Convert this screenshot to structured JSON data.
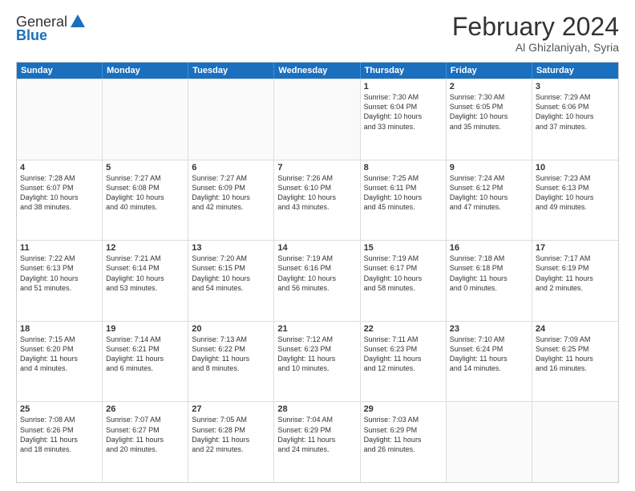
{
  "logo": {
    "general": "General",
    "blue": "Blue"
  },
  "title": "February 2024",
  "location": "Al Ghizlaniyah, Syria",
  "days_of_week": [
    "Sunday",
    "Monday",
    "Tuesday",
    "Wednesday",
    "Thursday",
    "Friday",
    "Saturday"
  ],
  "weeks": [
    [
      {
        "day": "",
        "text": ""
      },
      {
        "day": "",
        "text": ""
      },
      {
        "day": "",
        "text": ""
      },
      {
        "day": "",
        "text": ""
      },
      {
        "day": "1",
        "text": "Sunrise: 7:30 AM\nSunset: 6:04 PM\nDaylight: 10 hours\nand 33 minutes."
      },
      {
        "day": "2",
        "text": "Sunrise: 7:30 AM\nSunset: 6:05 PM\nDaylight: 10 hours\nand 35 minutes."
      },
      {
        "day": "3",
        "text": "Sunrise: 7:29 AM\nSunset: 6:06 PM\nDaylight: 10 hours\nand 37 minutes."
      }
    ],
    [
      {
        "day": "4",
        "text": "Sunrise: 7:28 AM\nSunset: 6:07 PM\nDaylight: 10 hours\nand 38 minutes."
      },
      {
        "day": "5",
        "text": "Sunrise: 7:27 AM\nSunset: 6:08 PM\nDaylight: 10 hours\nand 40 minutes."
      },
      {
        "day": "6",
        "text": "Sunrise: 7:27 AM\nSunset: 6:09 PM\nDaylight: 10 hours\nand 42 minutes."
      },
      {
        "day": "7",
        "text": "Sunrise: 7:26 AM\nSunset: 6:10 PM\nDaylight: 10 hours\nand 43 minutes."
      },
      {
        "day": "8",
        "text": "Sunrise: 7:25 AM\nSunset: 6:11 PM\nDaylight: 10 hours\nand 45 minutes."
      },
      {
        "day": "9",
        "text": "Sunrise: 7:24 AM\nSunset: 6:12 PM\nDaylight: 10 hours\nand 47 minutes."
      },
      {
        "day": "10",
        "text": "Sunrise: 7:23 AM\nSunset: 6:13 PM\nDaylight: 10 hours\nand 49 minutes."
      }
    ],
    [
      {
        "day": "11",
        "text": "Sunrise: 7:22 AM\nSunset: 6:13 PM\nDaylight: 10 hours\nand 51 minutes."
      },
      {
        "day": "12",
        "text": "Sunrise: 7:21 AM\nSunset: 6:14 PM\nDaylight: 10 hours\nand 53 minutes."
      },
      {
        "day": "13",
        "text": "Sunrise: 7:20 AM\nSunset: 6:15 PM\nDaylight: 10 hours\nand 54 minutes."
      },
      {
        "day": "14",
        "text": "Sunrise: 7:19 AM\nSunset: 6:16 PM\nDaylight: 10 hours\nand 56 minutes."
      },
      {
        "day": "15",
        "text": "Sunrise: 7:19 AM\nSunset: 6:17 PM\nDaylight: 10 hours\nand 58 minutes."
      },
      {
        "day": "16",
        "text": "Sunrise: 7:18 AM\nSunset: 6:18 PM\nDaylight: 11 hours\nand 0 minutes."
      },
      {
        "day": "17",
        "text": "Sunrise: 7:17 AM\nSunset: 6:19 PM\nDaylight: 11 hours\nand 2 minutes."
      }
    ],
    [
      {
        "day": "18",
        "text": "Sunrise: 7:15 AM\nSunset: 6:20 PM\nDaylight: 11 hours\nand 4 minutes."
      },
      {
        "day": "19",
        "text": "Sunrise: 7:14 AM\nSunset: 6:21 PM\nDaylight: 11 hours\nand 6 minutes."
      },
      {
        "day": "20",
        "text": "Sunrise: 7:13 AM\nSunset: 6:22 PM\nDaylight: 11 hours\nand 8 minutes."
      },
      {
        "day": "21",
        "text": "Sunrise: 7:12 AM\nSunset: 6:23 PM\nDaylight: 11 hours\nand 10 minutes."
      },
      {
        "day": "22",
        "text": "Sunrise: 7:11 AM\nSunset: 6:23 PM\nDaylight: 11 hours\nand 12 minutes."
      },
      {
        "day": "23",
        "text": "Sunrise: 7:10 AM\nSunset: 6:24 PM\nDaylight: 11 hours\nand 14 minutes."
      },
      {
        "day": "24",
        "text": "Sunrise: 7:09 AM\nSunset: 6:25 PM\nDaylight: 11 hours\nand 16 minutes."
      }
    ],
    [
      {
        "day": "25",
        "text": "Sunrise: 7:08 AM\nSunset: 6:26 PM\nDaylight: 11 hours\nand 18 minutes."
      },
      {
        "day": "26",
        "text": "Sunrise: 7:07 AM\nSunset: 6:27 PM\nDaylight: 11 hours\nand 20 minutes."
      },
      {
        "day": "27",
        "text": "Sunrise: 7:05 AM\nSunset: 6:28 PM\nDaylight: 11 hours\nand 22 minutes."
      },
      {
        "day": "28",
        "text": "Sunrise: 7:04 AM\nSunset: 6:29 PM\nDaylight: 11 hours\nand 24 minutes."
      },
      {
        "day": "29",
        "text": "Sunrise: 7:03 AM\nSunset: 6:29 PM\nDaylight: 11 hours\nand 26 minutes."
      },
      {
        "day": "",
        "text": ""
      },
      {
        "day": "",
        "text": ""
      }
    ]
  ]
}
